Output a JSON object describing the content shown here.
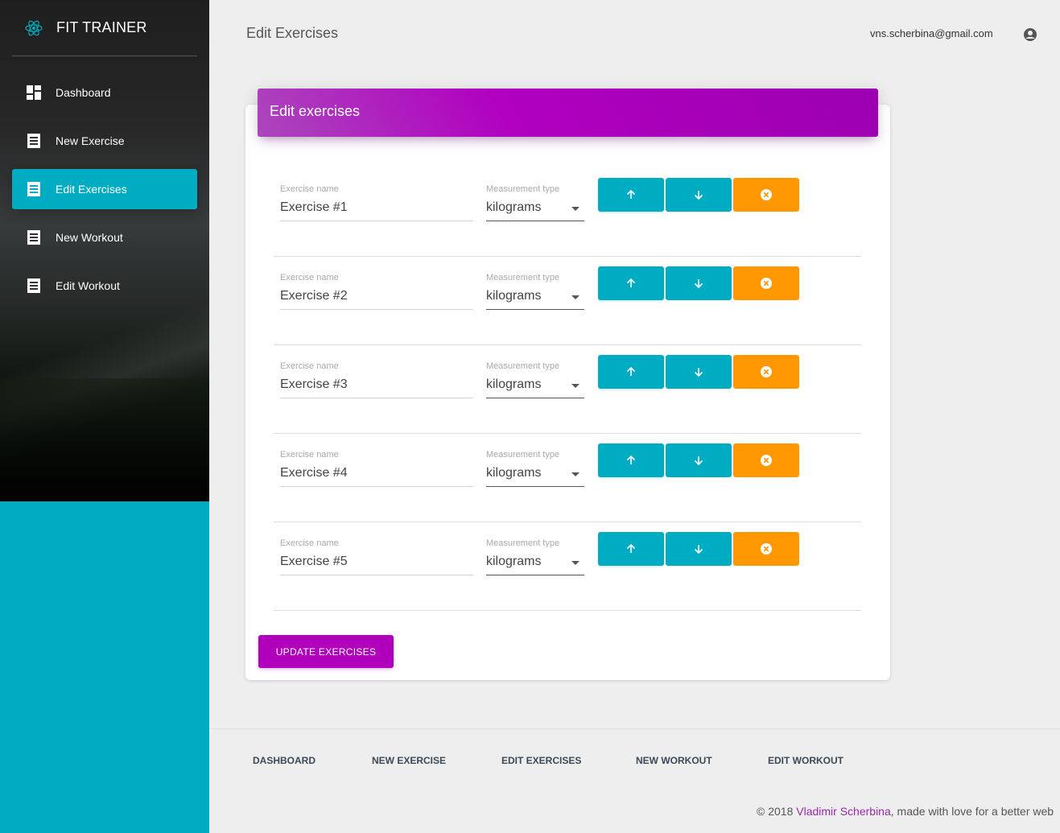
{
  "app": {
    "brand": "FIT TRAINER",
    "accent_color": "#00acc1",
    "primary_color": "#9c27b0",
    "warning_color": "#ff9800"
  },
  "sidebar": {
    "items": [
      {
        "label": "Dashboard",
        "icon": "dashboard-icon",
        "active": false
      },
      {
        "label": "New Exercise",
        "icon": "list-icon",
        "active": false
      },
      {
        "label": "Edit Exercises",
        "icon": "list-icon",
        "active": true
      },
      {
        "label": "New Workout",
        "icon": "list-icon",
        "active": false
      },
      {
        "label": "Edit Workout",
        "icon": "list-icon",
        "active": false
      }
    ]
  },
  "header": {
    "title": "Edit Exercises",
    "user_email": "vns.scherbina@gmail.com"
  },
  "card": {
    "title": "Edit exercises",
    "name_label": "Exercise name",
    "type_label": "Measurement type",
    "exercises": [
      {
        "name": "Exercise #1",
        "type": "kilograms"
      },
      {
        "name": "Exercise #2",
        "type": "kilograms"
      },
      {
        "name": "Exercise #3",
        "type": "kilograms"
      },
      {
        "name": "Exercise #4",
        "type": "kilograms"
      },
      {
        "name": "Exercise #5",
        "type": "kilograms"
      }
    ],
    "update_label": "UPDATE EXERCISES"
  },
  "footer": {
    "links": [
      "DASHBOARD",
      "NEW EXERCISE",
      "EDIT EXERCISES",
      "NEW WORKOUT",
      "EDIT WORKOUT"
    ],
    "copyright_prefix": "© 2018 ",
    "author": "Vladimir Scherbina",
    "copyright_suffix": ", made with love for a better web"
  }
}
